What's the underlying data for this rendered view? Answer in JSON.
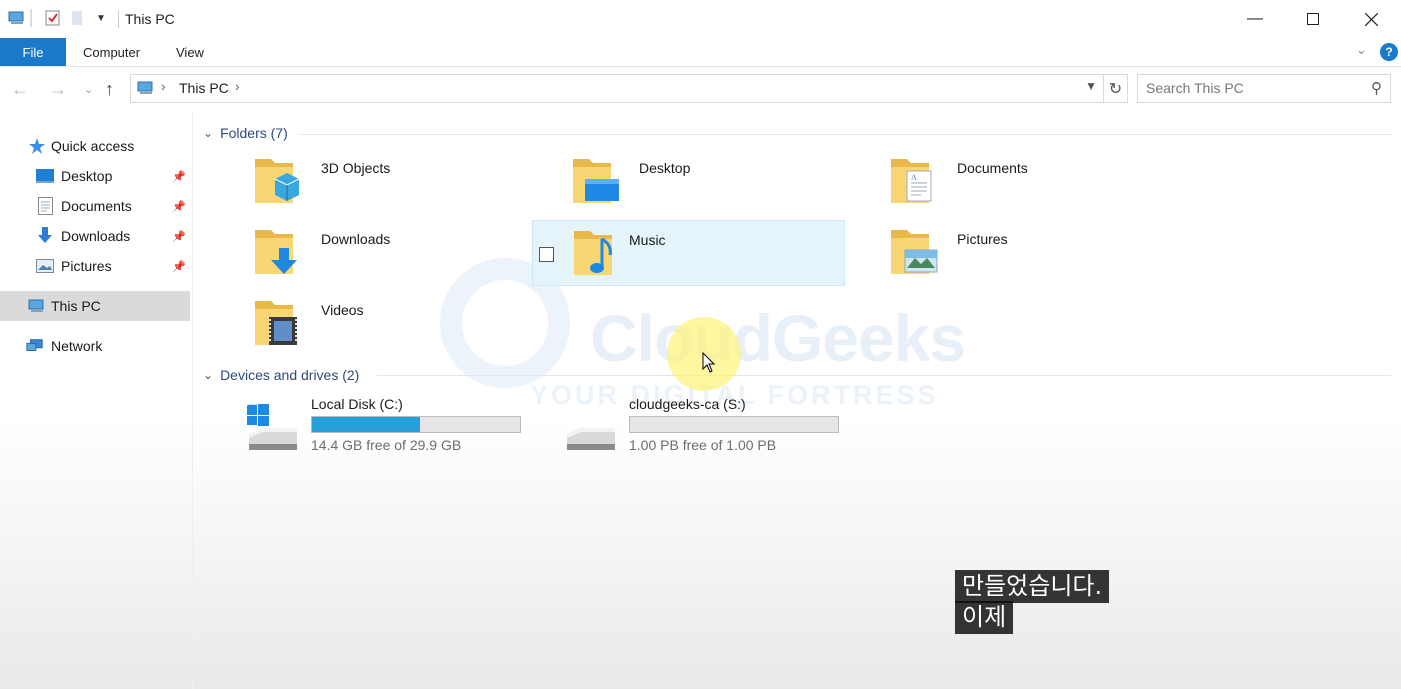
{
  "window": {
    "title": "This PC",
    "minimize_icon": "minimize-icon",
    "maximize_icon": "maximize-icon",
    "close_icon": "close-icon"
  },
  "ribbon": {
    "tabs": [
      "File",
      "Computer",
      "View"
    ],
    "help": "?"
  },
  "address": {
    "location": "This PC",
    "search_placeholder": "Search This PC"
  },
  "sidebar": {
    "items": [
      {
        "label": "Quick access",
        "icon": "star-icon"
      },
      {
        "label": "Desktop",
        "icon": "desktop-icon",
        "pinned": true
      },
      {
        "label": "Documents",
        "icon": "documents-icon",
        "pinned": true
      },
      {
        "label": "Downloads",
        "icon": "downloads-icon",
        "pinned": true
      },
      {
        "label": "Pictures",
        "icon": "pictures-icon",
        "pinned": true
      },
      {
        "label": "This PC",
        "icon": "computer-icon",
        "selected": true
      },
      {
        "label": "Network",
        "icon": "network-icon"
      }
    ]
  },
  "folders": {
    "header": "Folders (7)",
    "items": [
      {
        "label": "3D Objects",
        "icon": "3d-objects-folder-icon"
      },
      {
        "label": "Desktop",
        "icon": "desktop-folder-icon"
      },
      {
        "label": "Documents",
        "icon": "documents-folder-icon"
      },
      {
        "label": "Downloads",
        "icon": "downloads-folder-icon"
      },
      {
        "label": "Music",
        "icon": "music-folder-icon",
        "hovered": true
      },
      {
        "label": "Pictures",
        "icon": "pictures-folder-icon"
      },
      {
        "label": "Videos",
        "icon": "videos-folder-icon"
      }
    ]
  },
  "drives": {
    "header": "Devices and drives (2)",
    "items": [
      {
        "name": "Local Disk (C:)",
        "free_text": "14.4 GB free of 29.9 GB",
        "used_fraction": 0.52
      },
      {
        "name": "cloudgeeks-ca (S:)",
        "free_text": "1.00 PB free of 1.00 PB",
        "used_fraction": 0.0
      }
    ]
  },
  "watermark": {
    "brand": "CloudGeeks",
    "tagline": "YOUR DIGITAL FORTRESS"
  },
  "subtitles": [
    "만들었습니다.",
    "이제"
  ],
  "colors": {
    "accent": "#1979ca",
    "progress": "#26a0da",
    "hover": "#e5f3fb",
    "group_header": "#2c4a7d"
  }
}
